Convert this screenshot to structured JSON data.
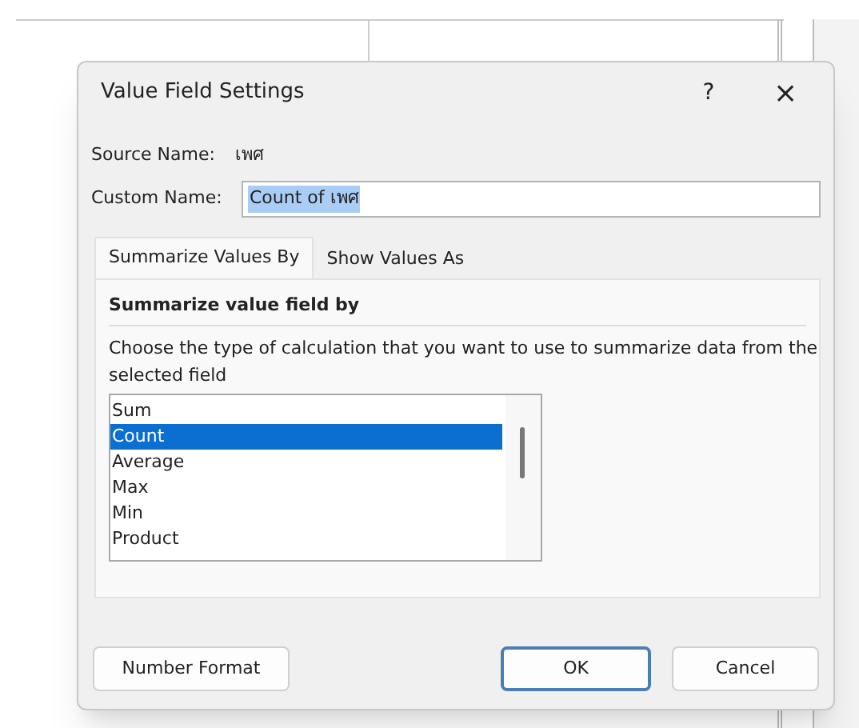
{
  "dialog": {
    "title": "Value Field Settings",
    "help": "?",
    "close": "×"
  },
  "source_name": {
    "label": "Source Name:",
    "value": "เพศ"
  },
  "custom_name": {
    "label": "Custom Name:",
    "value": "Count of เพศ",
    "text_selected": true
  },
  "tabs": [
    {
      "label": "Summarize Values By",
      "selected": true
    },
    {
      "label": "Show Values As",
      "selected": false
    }
  ],
  "panel": {
    "heading": "Summarize value field by",
    "description": "Choose the type of calculation that you want to use to summarize data from the selected field"
  },
  "functions": [
    {
      "label": "Sum",
      "selected": false
    },
    {
      "label": "Count",
      "selected": true
    },
    {
      "label": "Average",
      "selected": false
    },
    {
      "label": "Max",
      "selected": false
    },
    {
      "label": "Min",
      "selected": false
    },
    {
      "label": "Product",
      "selected": false
    }
  ],
  "buttons": [
    {
      "label": "Number Format",
      "kind": "left"
    },
    {
      "label": "OK",
      "kind": "default"
    },
    {
      "label": "Cancel",
      "kind": "normal"
    }
  ]
}
